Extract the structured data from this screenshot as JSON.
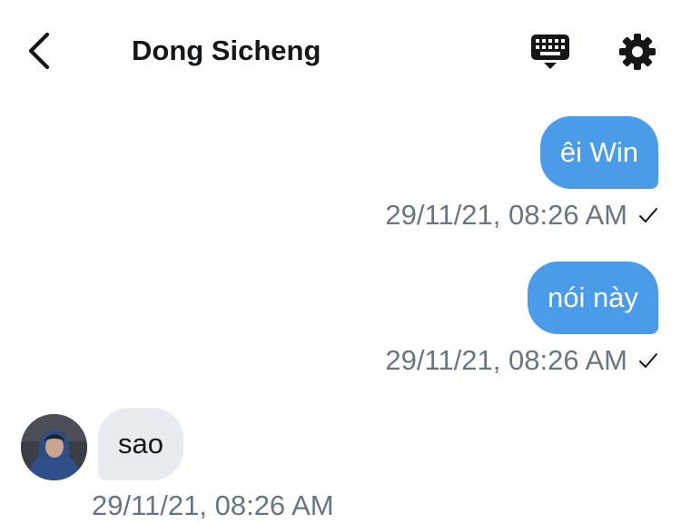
{
  "header": {
    "title": "Dong Sicheng",
    "back_icon": "chevron-left-icon",
    "keyboard_icon": "keyboard-icon",
    "settings_icon": "gear-icon"
  },
  "messages": [
    {
      "direction": "outgoing",
      "text": "êi Win",
      "timestamp": "29/11/21, 08:26 AM",
      "status_icon": "checkmark-icon"
    },
    {
      "direction": "outgoing",
      "text": "nói này",
      "timestamp": "29/11/21, 08:26 AM",
      "status_icon": "checkmark-icon"
    },
    {
      "direction": "incoming",
      "text": "sao",
      "timestamp": "29/11/21, 08:26 AM",
      "avatar": "avatar-photo"
    }
  ],
  "colors": {
    "outgoing_bubble": "#4a9ce9",
    "incoming_bubble": "#e8ecf0",
    "timestamp": "#657786",
    "title": "#14171a"
  }
}
